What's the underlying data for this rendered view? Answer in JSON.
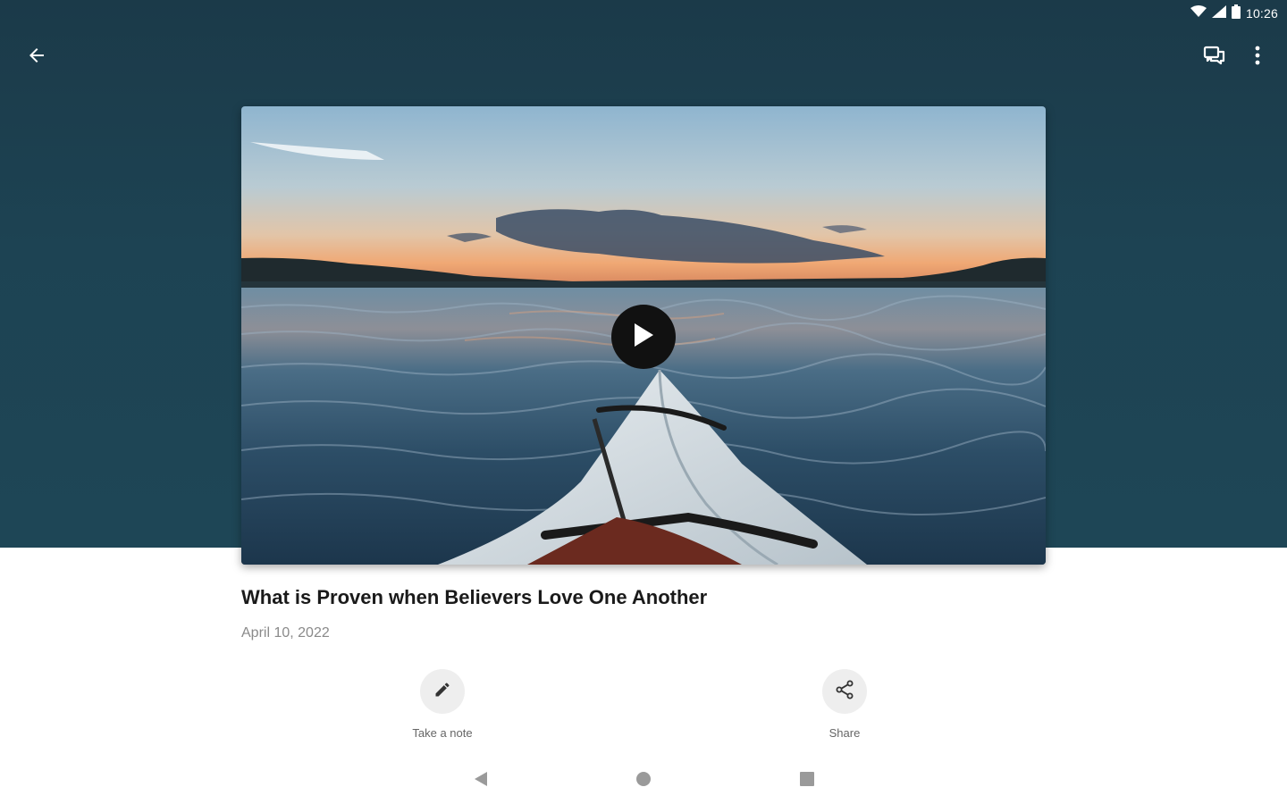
{
  "status_bar": {
    "time": "10:26",
    "icons": [
      "wifi-icon",
      "signal-icon",
      "battery-icon"
    ]
  },
  "toolbar": {
    "back_icon": "arrow-back-icon",
    "notes_icon": "chat-bubbles-icon",
    "more_icon": "more-vertical-icon"
  },
  "media": {
    "thumbnail": "kayak-on-lake-at-sunset",
    "play_icon": "play-icon"
  },
  "sermon": {
    "title": "What is Proven when Believers Love One Another",
    "date": "April 10, 2022"
  },
  "actions": [
    {
      "label": "Take a note",
      "icon": "pencil-icon"
    },
    {
      "label": "Share",
      "icon": "share-icon"
    }
  ],
  "nav_bar": {
    "icons": [
      "nav-back-icon",
      "nav-home-icon",
      "nav-recents-icon"
    ]
  },
  "colors": {
    "header_background": "#1d4353",
    "page_background": "#ffffff",
    "title_text": "#1a1a1a",
    "date_text": "#8a8a8a",
    "action_circle": "#eeeeee"
  }
}
